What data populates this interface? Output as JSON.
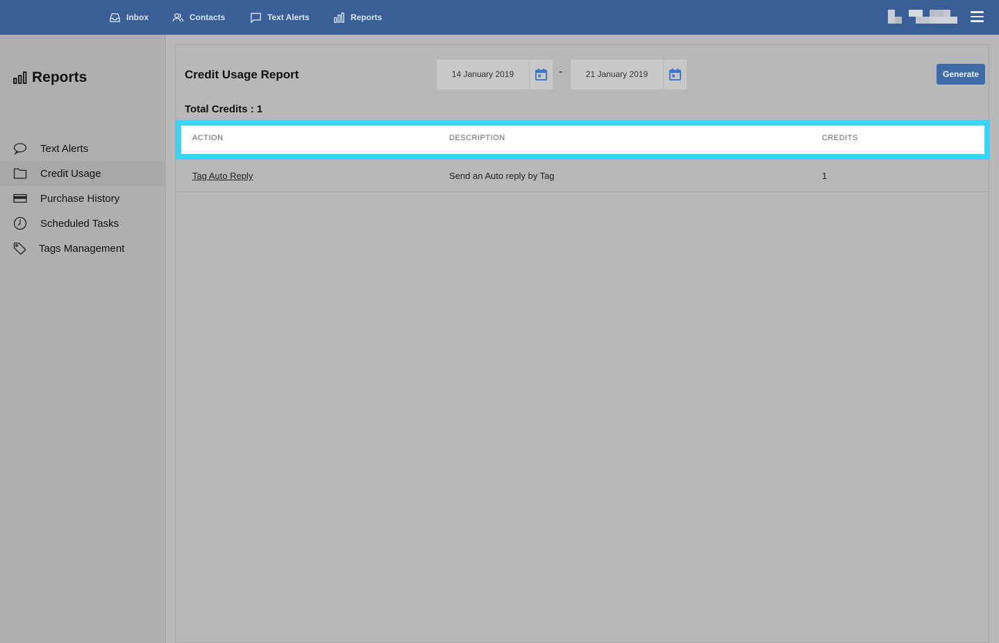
{
  "topnav": {
    "items": [
      {
        "label": "Inbox",
        "icon": "inbox-icon"
      },
      {
        "label": "Contacts",
        "icon": "contacts-icon"
      },
      {
        "label": "Text Alerts",
        "icon": "chat-bubble-icon"
      },
      {
        "label": "Reports",
        "icon": "bar-chart-icon"
      }
    ],
    "menu_icon": "hamburger-menu-icon"
  },
  "sidebar": {
    "title": "Reports",
    "items": [
      {
        "label": "Text Alerts",
        "icon": "chat-bubble-icon"
      },
      {
        "label": "Credit Usage",
        "icon": "folder-icon",
        "active": true
      },
      {
        "label": "Purchase History",
        "icon": "credit-card-icon"
      },
      {
        "label": "Scheduled Tasks",
        "icon": "clock-icon"
      },
      {
        "label": "Tags Management",
        "icon": "tag-icon"
      }
    ]
  },
  "report": {
    "title": "Credit Usage Report",
    "start_date": "14 January 2019",
    "separator": "-",
    "end_date": "21 January 2019",
    "generate_label": "Generate",
    "total_credits": "Total Credits : 1",
    "columns": [
      "ACTION",
      "DESCRIPTION",
      "CREDITS"
    ],
    "rows": [
      {
        "action": "Tag Auto Reply",
        "description": "Send an Auto reply by Tag",
        "credits": "1"
      }
    ]
  },
  "colors": {
    "topbar": "#3a5f96",
    "accent_button": "#3e6aa6",
    "calendar_icon": "#3b78c8",
    "header_highlight": "#3fd2f5"
  }
}
